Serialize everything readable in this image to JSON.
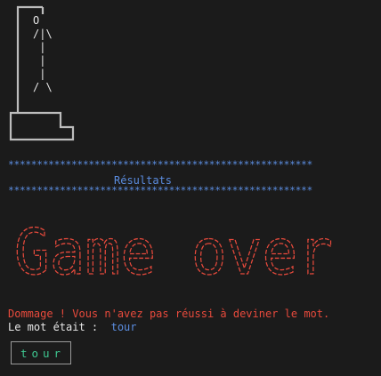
{
  "gallows": {
    "figure": "O\n/|\\\n |\n |\n |\n/ \\"
  },
  "results": {
    "stars": "*****************************************************",
    "title": "Résultats"
  },
  "banner": {
    "text": "Game over"
  },
  "colors": {
    "background": "#1b1b1b",
    "accent_blue": "#5b8de0",
    "error_red": "#e84a3c",
    "word_green": "#3ec690",
    "frame_gray": "#bdbdbd"
  },
  "message": {
    "defeat": "Dommage ! Vous n'avez pas réussi à deviner le mot.",
    "reveal_label": "Le mot était : ",
    "word": "tour",
    "word_spaced": "tour"
  }
}
